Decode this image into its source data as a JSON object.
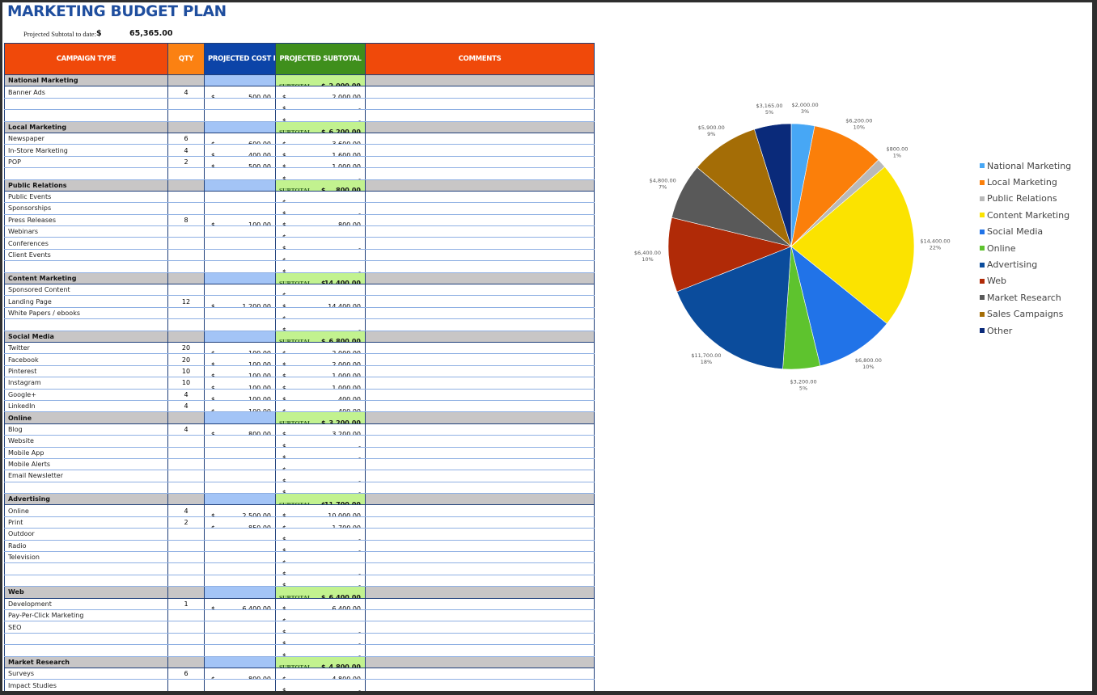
{
  "page": {
    "title": "MARKETING BUDGET PLAN",
    "projected_subtotal_label": "Projected Subtotal to date:",
    "projected_subtotal_currency": "$",
    "projected_subtotal_value": "65,365.00"
  },
  "table": {
    "headers": {
      "campaign_type": "CAMPAIGN TYPE",
      "qty": "QTY",
      "cost_per_unit": "PROJECTED COST PER UNIT",
      "projected_subtotal": "PROJECTED SUBTOTAL",
      "comments": "COMMENTS"
    },
    "subtotal_label": "SUBTOTAL",
    "currency": "$",
    "empty_value": "-",
    "categories": [
      {
        "name": "National Marketing",
        "subtotal": "2,000.00",
        "items": [
          {
            "name": "Banner Ads",
            "qty": "4",
            "cost": "500.00",
            "subtotal": "2,000.00"
          },
          {
            "name": "",
            "qty": "",
            "cost": "",
            "subtotal": "-"
          },
          {
            "name": "",
            "qty": "",
            "cost": "",
            "subtotal": "-"
          }
        ]
      },
      {
        "name": "Local Marketing",
        "subtotal": "6,200.00",
        "items": [
          {
            "name": "Newspaper",
            "qty": "6",
            "cost": "600.00",
            "subtotal": "3,600.00"
          },
          {
            "name": "In-Store Marketing",
            "qty": "4",
            "cost": "400.00",
            "subtotal": "1,600.00"
          },
          {
            "name": "POP",
            "qty": "2",
            "cost": "500.00",
            "subtotal": "1,000.00"
          },
          {
            "name": "",
            "qty": "",
            "cost": "",
            "subtotal": "-"
          }
        ]
      },
      {
        "name": "Public Relations",
        "subtotal": "800.00",
        "items": [
          {
            "name": "Public Events",
            "qty": "",
            "cost": "",
            "subtotal": "-"
          },
          {
            "name": "Sponsorships",
            "qty": "",
            "cost": "",
            "subtotal": "-"
          },
          {
            "name": "Press Releases",
            "qty": "8",
            "cost": "100.00",
            "subtotal": "800.00"
          },
          {
            "name": "Webinars",
            "qty": "",
            "cost": "",
            "subtotal": "-"
          },
          {
            "name": "Conferences",
            "qty": "",
            "cost": "",
            "subtotal": "-"
          },
          {
            "name": "Client Events",
            "qty": "",
            "cost": "",
            "subtotal": "-"
          },
          {
            "name": "",
            "qty": "",
            "cost": "",
            "subtotal": "-"
          }
        ]
      },
      {
        "name": "Content Marketing",
        "subtotal": "14,400.00",
        "items": [
          {
            "name": "Sponsored Content",
            "qty": "",
            "cost": "",
            "subtotal": "-"
          },
          {
            "name": "Landing Page",
            "qty": "12",
            "cost": "1,200.00",
            "subtotal": "14,400.00"
          },
          {
            "name": "White Papers / ebooks",
            "qty": "",
            "cost": "",
            "subtotal": "-"
          },
          {
            "name": "",
            "qty": "",
            "cost": "",
            "subtotal": "-"
          }
        ]
      },
      {
        "name": "Social Media",
        "subtotal": "6,800.00",
        "items": [
          {
            "name": "Twitter",
            "qty": "20",
            "cost": "100.00",
            "subtotal": "2,000.00"
          },
          {
            "name": "Facebook",
            "qty": "20",
            "cost": "100.00",
            "subtotal": "2,000.00"
          },
          {
            "name": "Pinterest",
            "qty": "10",
            "cost": "100.00",
            "subtotal": "1,000.00"
          },
          {
            "name": "Instagram",
            "qty": "10",
            "cost": "100.00",
            "subtotal": "1,000.00"
          },
          {
            "name": "Google+",
            "qty": "4",
            "cost": "100.00",
            "subtotal": "400.00"
          },
          {
            "name": "LinkedIn",
            "qty": "4",
            "cost": "100.00",
            "subtotal": "400.00"
          }
        ]
      },
      {
        "name": "Online",
        "subtotal": "3,200.00",
        "items": [
          {
            "name": "Blog",
            "qty": "4",
            "cost": "800.00",
            "subtotal": "3,200.00"
          },
          {
            "name": "Website",
            "qty": "",
            "cost": "",
            "subtotal": "-"
          },
          {
            "name": "Mobile App",
            "qty": "",
            "cost": "",
            "subtotal": "-"
          },
          {
            "name": "Mobile Alerts",
            "qty": "",
            "cost": "",
            "subtotal": "-"
          },
          {
            "name": "Email Newsletter",
            "qty": "",
            "cost": "",
            "subtotal": "-"
          },
          {
            "name": "",
            "qty": "",
            "cost": "",
            "subtotal": "-"
          }
        ]
      },
      {
        "name": "Advertising",
        "subtotal": "11,700.00",
        "items": [
          {
            "name": "Online",
            "qty": "4",
            "cost": "2,500.00",
            "subtotal": "10,000.00"
          },
          {
            "name": "Print",
            "qty": "2",
            "cost": "850.00",
            "subtotal": "1,700.00"
          },
          {
            "name": "Outdoor",
            "qty": "",
            "cost": "",
            "subtotal": "-"
          },
          {
            "name": "Radio",
            "qty": "",
            "cost": "",
            "subtotal": "-"
          },
          {
            "name": "Television",
            "qty": "",
            "cost": "",
            "subtotal": "-"
          },
          {
            "name": "",
            "qty": "",
            "cost": "",
            "subtotal": "-"
          },
          {
            "name": "",
            "qty": "",
            "cost": "",
            "subtotal": "-"
          }
        ]
      },
      {
        "name": "Web",
        "subtotal": "6,400.00",
        "items": [
          {
            "name": "Development",
            "qty": "1",
            "cost": "6,400.00",
            "subtotal": "6,400.00"
          },
          {
            "name": "Pay-Per-Click Marketing",
            "qty": "",
            "cost": "",
            "subtotal": "-"
          },
          {
            "name": "SEO",
            "qty": "",
            "cost": "",
            "subtotal": "-"
          },
          {
            "name": "",
            "qty": "",
            "cost": "",
            "subtotal": "-"
          },
          {
            "name": "",
            "qty": "",
            "cost": "",
            "subtotal": "-"
          }
        ]
      },
      {
        "name": "Market Research",
        "subtotal": "4,800.00",
        "items": [
          {
            "name": "Surveys",
            "qty": "6",
            "cost": "800.00",
            "subtotal": "4,800.00"
          },
          {
            "name": "Impact Studies",
            "qty": "",
            "cost": "",
            "subtotal": "-"
          }
        ]
      }
    ]
  },
  "chart_data": {
    "type": "pie",
    "title": "",
    "legend_position": "right",
    "categories": [
      "National Marketing",
      "Local Marketing",
      "Public Relations",
      "Content Marketing",
      "Social Media",
      "Online",
      "Advertising",
      "Web",
      "Market Research",
      "Sales Campaigns",
      "Other"
    ],
    "values": [
      2000,
      6200,
      800,
      14400,
      6800,
      3200,
      11700,
      6400,
      4800,
      5900,
      3165
    ],
    "value_labels": [
      "$2,000.00",
      "$6,200.00",
      "$800.00",
      "$14,400.00",
      "$6,800.00",
      "$3,200.00",
      "$11,700.00",
      "$6,400.00",
      "$4,800.00",
      "$5,900.00",
      "$3,165.00"
    ],
    "percent_labels": [
      "3%",
      "10%",
      "1%",
      "22%",
      "10%",
      "5%",
      "18%",
      "10%",
      "7%",
      "9%",
      "5%"
    ],
    "colors": [
      "#47a7f5",
      "#fb7f0a",
      "#b9b9b9",
      "#fbe300",
      "#2173e8",
      "#5ec32e",
      "#0b4c9c",
      "#b02a07",
      "#595959",
      "#a46d06",
      "#0a2a7a"
    ]
  }
}
